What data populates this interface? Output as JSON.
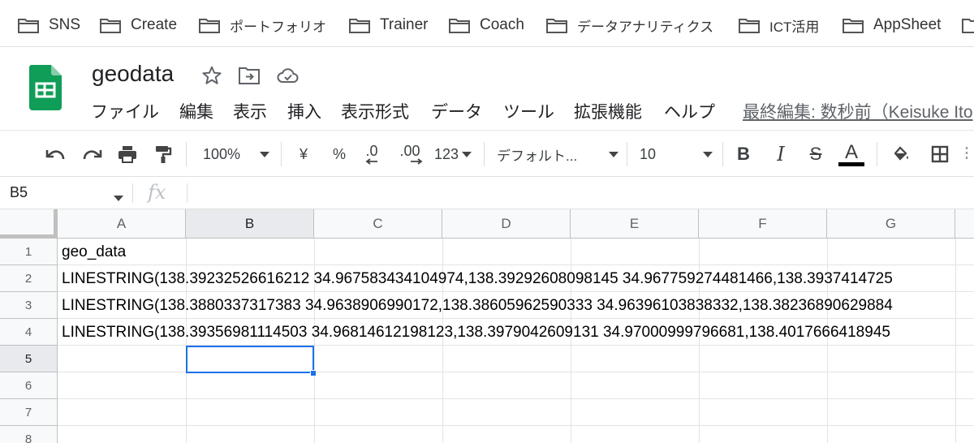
{
  "bookmarks": [
    {
      "label": "SNS",
      "icon": "folder-icon"
    },
    {
      "label": "Create",
      "icon": "folder-icon"
    },
    {
      "label": "ポートフォリオ",
      "icon": "folder-icon"
    },
    {
      "label": "Trainer",
      "icon": "folder-icon"
    },
    {
      "label": "Coach",
      "icon": "folder-icon"
    },
    {
      "label": "データアナリティクス",
      "icon": "folder-icon"
    },
    {
      "label": "ICT活用",
      "icon": "folder-icon"
    },
    {
      "label": "AppSheet",
      "icon": "folder-icon"
    }
  ],
  "document": {
    "title": "geodata",
    "last_edit": "最終編集: 数秒前（Keisuke Ito"
  },
  "menu": [
    "ファイル",
    "編集",
    "表示",
    "挿入",
    "表示形式",
    "データ",
    "ツール",
    "拡張機能",
    "ヘルプ"
  ],
  "toolbar": {
    "zoom": "100%",
    "currency": "¥",
    "percent": "%",
    "decrease_decimal": ".0",
    "increase_decimal": ".00",
    "more_formats": "123",
    "font": "デフォルト...",
    "font_size": "10",
    "bold": "B",
    "italic": "I",
    "strikethrough": "S",
    "text_color": "A"
  },
  "formula_bar": {
    "name_box": "B5",
    "fx": "fx",
    "content": ""
  },
  "grid": {
    "columns": [
      "A",
      "B",
      "C",
      "D",
      "E",
      "F",
      "G"
    ],
    "rows": [
      "1",
      "2",
      "3",
      "4",
      "5",
      "6",
      "7",
      "8"
    ],
    "selected_cell": "B5",
    "cells": {
      "A1": "geo_data",
      "A2": "LINESTRING(138.39232526616212 34.967583434104974,138.39292608098145 34.967759274481466,138.3937414725",
      "A3": "LINESTRING(138.3880337317383 34.9638906990172,138.38605962590333 34.96396103838332,138.38236890629884",
      "A4": "LINESTRING(138.39356981114503 34.96814612198123,138.3979042609131 34.97000999796681,138.4017666418945"
    }
  },
  "colors": {
    "accent": "#1a73e8",
    "sheets_green": "#0f9d58",
    "header_bg": "#f8f9fa"
  }
}
